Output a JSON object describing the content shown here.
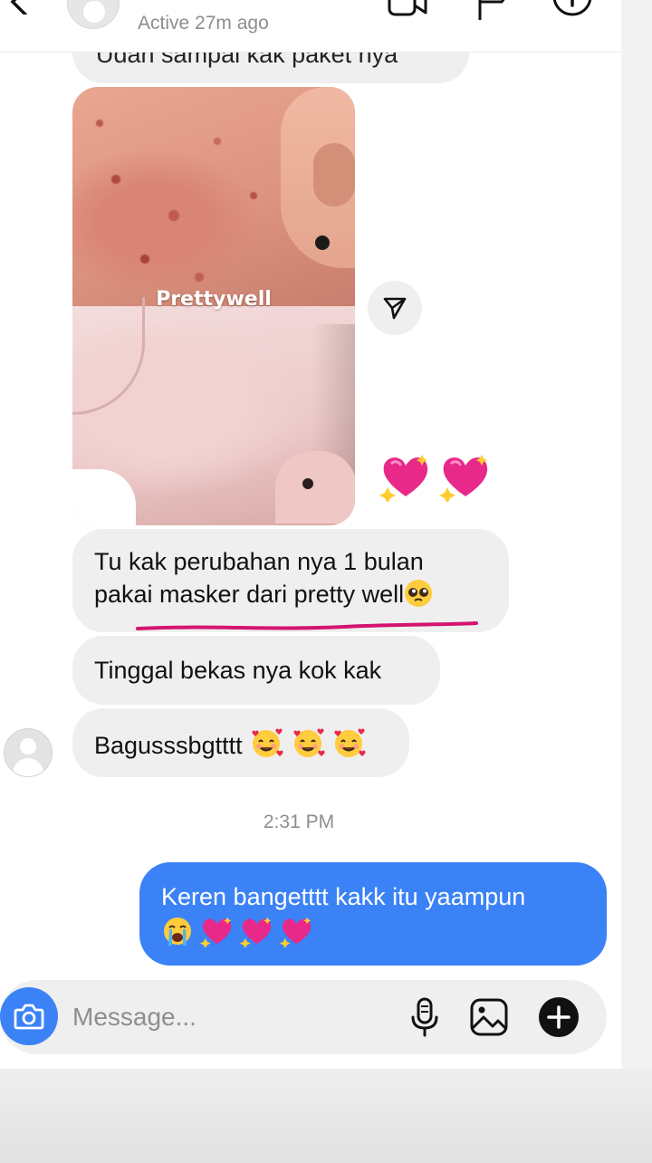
{
  "header": {
    "status": "Active 27m ago"
  },
  "messages": {
    "cut_off": "Udah sampai kak paket nya",
    "photo_watermark": "Prettywell",
    "change_line1": "Tu kak perubahan nya 1 bulan",
    "change_line2": "pakai masker dari pretty well",
    "scar": "Tinggal bekas nya kok kak",
    "bagus": "Bagusssbgtttt",
    "timestamp": "2:31 PM",
    "sent": "Keren bangetttt kakk itu yaampun"
  },
  "composer": {
    "placeholder": "Message..."
  },
  "icons": {
    "back": "chevron-left-icon",
    "video": "video-call-icon",
    "flag": "flag-icon",
    "info": "info-icon",
    "share": "send-icon",
    "camera": "camera-icon",
    "mic": "microphone-icon",
    "gallery": "image-icon",
    "plus": "plus-icon",
    "reaction": "sparkling-heart-emoji",
    "pleading": "pleading-face-emoji",
    "smiling_hearts": "smiling-face-with-hearts-emoji",
    "crying": "loudly-crying-face-emoji"
  },
  "colors": {
    "sent_bubble": "#3b82f6",
    "received_bubble": "#efefef",
    "underline": "#d4146f",
    "camera_button": "#3b82f6"
  }
}
